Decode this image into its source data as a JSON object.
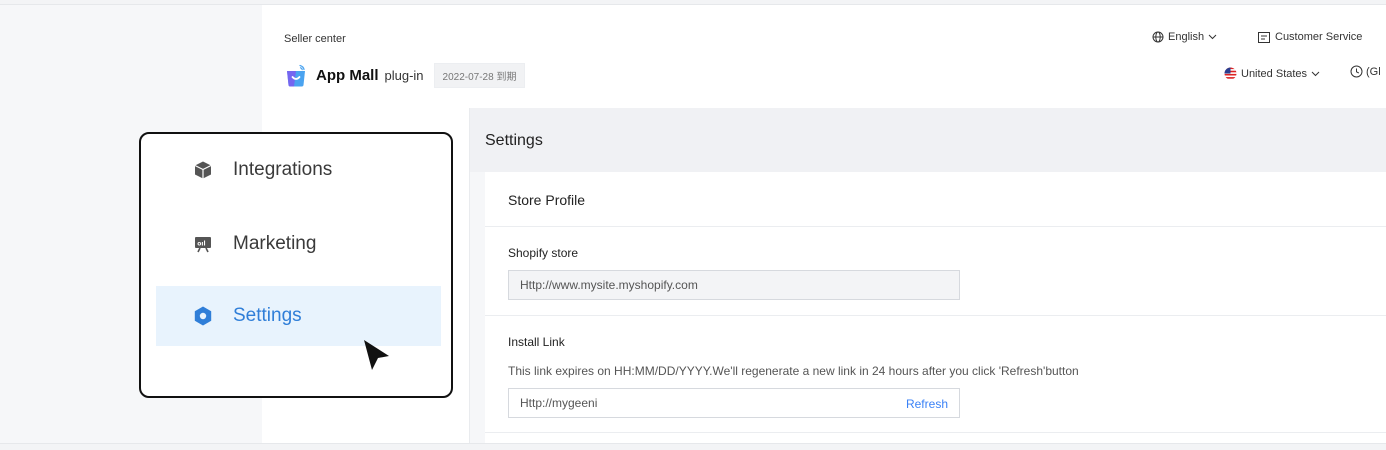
{
  "header": {
    "seller_center": "Seller center",
    "language": "English",
    "customer_service": "Customer Service",
    "app_name": "App Mall",
    "plugin_label": "plug-in",
    "expire_badge": "2022-07-28 到期",
    "country": "United States",
    "clock_text": "(Gl"
  },
  "sidebar": {
    "items": [
      {
        "label": "Integrations",
        "icon": "cube-icon"
      },
      {
        "label": "Marketing",
        "icon": "billboard-icon"
      },
      {
        "label": "Settings",
        "icon": "gear-icon",
        "active": true
      }
    ]
  },
  "main": {
    "title": "Settings",
    "card_title": "Store Profile",
    "shopify_label": "Shopify store",
    "shopify_value": "Http://www.mysite.myshopify.com",
    "install_label": "Install Link",
    "install_help": "This link expires on HH:MM/DD/YYYY.We'll regenerate a new link in 24 hours after you click 'Refresh'button",
    "install_value": "Http://mygeeni",
    "refresh_label": "Refresh"
  },
  "colors": {
    "accent": "#3b82f6",
    "active_bg": "#e8f3fd",
    "active_text": "#2f7ed8"
  }
}
